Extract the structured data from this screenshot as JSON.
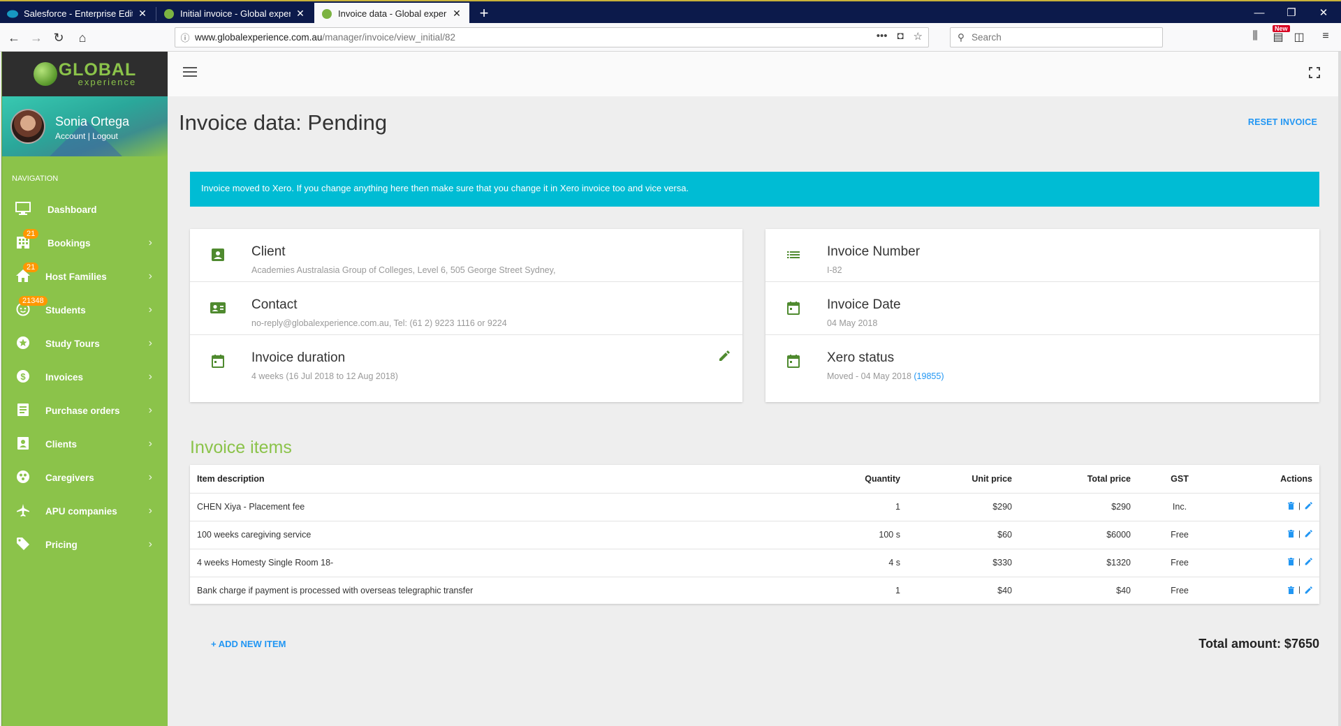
{
  "browser": {
    "tabs": [
      {
        "label": "Salesforce - Enterprise Edition",
        "active": false
      },
      {
        "label": "Initial invoice - Global experien",
        "active": false
      },
      {
        "label": "Invoice data - Global experienc",
        "active": true
      }
    ],
    "url_host": "www.globalexperience.com.au",
    "url_path": "/manager/invoice/view_initial/82",
    "search_placeholder": "Search",
    "new_badge": "New"
  },
  "sidebar": {
    "logo_line1": "GLOBAL",
    "logo_line2": "experience",
    "user_name": "Sonia Ortega",
    "account_link": "Account",
    "logout_link": "Logout",
    "nav_title": "NAVIGATION",
    "items": [
      {
        "label": "Dashboard",
        "icon": "monitor-icon",
        "badge": ""
      },
      {
        "label": "Bookings",
        "icon": "building-icon",
        "badge": "21"
      },
      {
        "label": "Host Families",
        "icon": "home-icon",
        "badge": "21"
      },
      {
        "label": "Students",
        "icon": "face-icon",
        "badge": "21348"
      },
      {
        "label": "Study Tours",
        "icon": "star-icon",
        "badge": ""
      },
      {
        "label": "Invoices",
        "icon": "dollar-icon",
        "badge": ""
      },
      {
        "label": "Purchase orders",
        "icon": "list-icon",
        "badge": ""
      },
      {
        "label": "Clients",
        "icon": "contact-icon",
        "badge": ""
      },
      {
        "label": "Caregivers",
        "icon": "group-icon",
        "badge": ""
      },
      {
        "label": "APU companies",
        "icon": "plane-icon",
        "badge": ""
      },
      {
        "label": "Pricing",
        "icon": "tag-icon",
        "badge": ""
      }
    ]
  },
  "page": {
    "title": "Invoice data: Pending",
    "reset_label": "RESET INVOICE",
    "alert": "Invoice moved to Xero. If you change anything here then make sure that you change it in Xero invoice too and vice versa."
  },
  "left_card": {
    "client_title": "Client",
    "client_value": "Academies Australasia Group of Colleges, Level 6, 505 George Street Sydney,",
    "contact_title": "Contact",
    "contact_value": "no-reply@globalexperience.com.au, Tel: (61 2) 9223 1116 or 9224",
    "duration_title": "Invoice duration",
    "duration_value": "4 weeks (16 Jul 2018 to 12 Aug 2018)"
  },
  "right_card": {
    "number_title": "Invoice Number",
    "number_value": "I-82",
    "date_title": "Invoice Date",
    "date_value": "04 May 2018",
    "xero_title": "Xero status",
    "xero_value": "Moved - 04 May 2018",
    "xero_link": "(19855)"
  },
  "items": {
    "section_title": "Invoice items",
    "headers": {
      "description": "Item description",
      "quantity": "Quantity",
      "unit_price": "Unit price",
      "total_price": "Total price",
      "gst": "GST",
      "actions": "Actions"
    },
    "rows": [
      {
        "description": "CHEN Xiya - Placement fee",
        "quantity": "1",
        "unit_price": "$290",
        "total_price": "$290",
        "gst": "Inc."
      },
      {
        "description": "100 weeks caregiving service",
        "quantity": "100 s",
        "unit_price": "$60",
        "total_price": "$6000",
        "gst": "Free"
      },
      {
        "description": "4 weeks Homesty Single Room 18-",
        "quantity": "4 s",
        "unit_price": "$330",
        "total_price": "$1320",
        "gst": "Free"
      },
      {
        "description": "Bank charge if payment is processed with overseas telegraphic transfer",
        "quantity": "1",
        "unit_price": "$40",
        "total_price": "$40",
        "gst": "Free"
      }
    ],
    "add_label": "+ ADD NEW ITEM",
    "total_label": "Total amount: $7650"
  }
}
